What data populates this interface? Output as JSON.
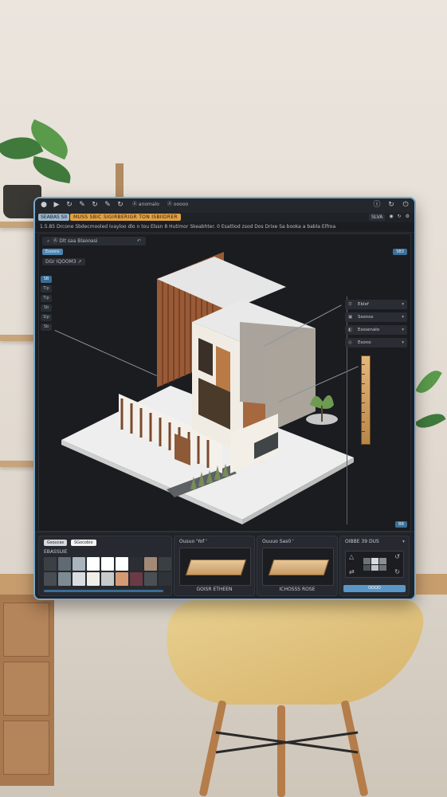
{
  "titlebar": {
    "file_label": "Ⓐ anomalo",
    "open_label": "Ⓐ ooooo"
  },
  "menubar": {
    "project_tag": "SEABAS SII",
    "project_title": "MUSS SBIC SIGIRBERIGR TON ISBIIDRER",
    "zoom_value": "SLVA",
    "right_icons": [
      "user-icon",
      "refresh-icon",
      "settings-icon"
    ]
  },
  "toolbar": {
    "text": "1.5.85 Drcone Sbdecmooled Ivayloo dlo n tou Elssn 8 Hutimor Skeabhter. 0 Esatliod zsod Dos Drixe Sa booka a babla Elfroa"
  },
  "viewport": {
    "search_label": "Ⓐ Dlt saa Blaooasi",
    "layer_chip": "Esoons",
    "view_chip": "SB3",
    "corner_chip": "BB",
    "tools_label": "DGr IQOOM3 ↗",
    "left_tools": [
      "SB",
      "Tip",
      "Tip",
      "Sb",
      "Sip",
      "Sb"
    ],
    "properties": [
      {
        "icon": "layers-icon",
        "label": "Eblef"
      },
      {
        "icon": "cube-icon",
        "label": "Ssonos"
      },
      {
        "icon": "material-icon",
        "label": "Esssenalo"
      },
      {
        "icon": "light-icon",
        "label": "Esono"
      }
    ]
  },
  "panels": {
    "materials": {
      "tab_1": "Gsoucas",
      "tab_2": "SGocobio",
      "title": "EBASSUIE",
      "swatches": [
        "#3b4045",
        "#5f6a72",
        "#a9b4bc",
        "#ffffff",
        "#ffffff",
        "#ffffff",
        "#2b2f33",
        "#a38a74",
        "#3a3f44",
        "#474d52",
        "#7f8b93",
        "#d9dde0",
        "#f1eee8",
        "#c8c9c9",
        "#d49a74",
        "#6b3a46",
        "#4a4f54",
        "#2f3337"
      ]
    },
    "board_1": {
      "title": "Ousuo 'Yof '",
      "caption": "GOISR ETHEEN"
    },
    "board_2": {
      "title": "Ouuuo Sas0 '",
      "caption": "ICHOSSS ROSE"
    },
    "ops": {
      "title": "OIBBE 39 DUS",
      "button": "OOOO"
    }
  },
  "colors": {
    "accent": "#5b97c6",
    "project_title_bg": "#e3a143"
  }
}
